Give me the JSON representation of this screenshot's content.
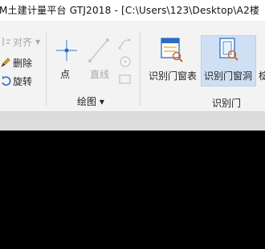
{
  "titlebar": {
    "title": "M土建计量平台 GTJ2018 - [C:\\Users\\123\\Desktop\\A2楼"
  },
  "ribbon": {
    "left_group": {
      "align_label": "对齐",
      "delete_label": "删除",
      "rotate_label": "旋转"
    },
    "draw_group": {
      "point_label": "点",
      "line_label": "直线",
      "group_label": "绘图 ▾"
    },
    "door_group": {
      "door_table_label": "识别门窗表",
      "door_hole_label": "识别门窗洞",
      "group_label": "识别门",
      "cutoff_label": "椗"
    }
  },
  "colors": {
    "accent": "#2b6cc4",
    "highlight": "#cfe0f5",
    "canvas": "#000000"
  }
}
